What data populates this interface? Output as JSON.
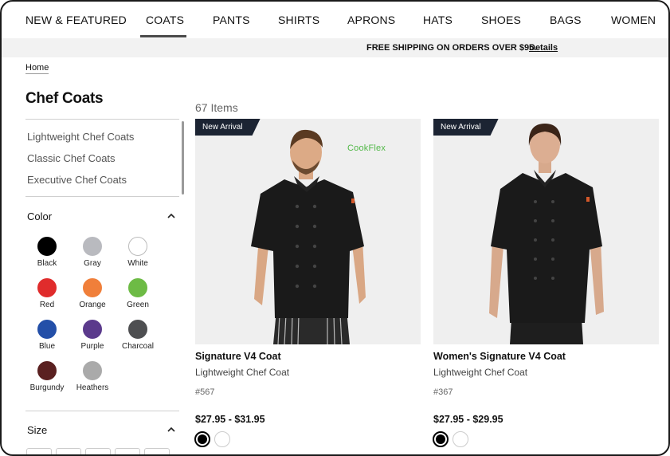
{
  "nav": {
    "items": [
      "NEW & FEATURED",
      "COATS",
      "PANTS",
      "SHIRTS",
      "APRONS",
      "HATS",
      "SHOES",
      "BAGS",
      "WOMEN"
    ],
    "active": "COATS"
  },
  "promo": {
    "text": "FREE SHIPPING ON ORDERS OVER $95.",
    "link": "Details"
  },
  "breadcrumb": "Home",
  "page_title": "Chef Coats",
  "categories": [
    "Lightweight Chef Coats",
    "Classic Chef Coats",
    "Executive Chef Coats"
  ],
  "color_facet": {
    "label": "Color",
    "swatches": [
      {
        "name": "Black",
        "color": "#000000"
      },
      {
        "name": "Gray",
        "color": "#b9babf"
      },
      {
        "name": "White",
        "color": "#ffffff"
      },
      {
        "name": "Red",
        "color": "#e02c2c"
      },
      {
        "name": "Orange",
        "color": "#f07f3a"
      },
      {
        "name": "Green",
        "color": "#6dbb45"
      },
      {
        "name": "Blue",
        "color": "#234fa8"
      },
      {
        "name": "Purple",
        "color": "#5b3a8c"
      },
      {
        "name": "Charcoal",
        "color": "#4e4f51"
      },
      {
        "name": "Burgundy",
        "color": "#5a2020"
      },
      {
        "name": "Heathers",
        "color": "#aaaaaa"
      }
    ]
  },
  "size_facet": {
    "label": "Size"
  },
  "results": {
    "count": "67 Items"
  },
  "products": [
    {
      "badge": "New Arrival",
      "brand_mark": "CookFlex",
      "name": "Signature V4 Coat",
      "subtitle": "Lightweight Chef Coat",
      "sku": "#567",
      "price": "$27.95 - $31.95",
      "swatches": [
        "#000000",
        "#ffffff"
      ]
    },
    {
      "badge": "New Arrival",
      "name": "Women's Signature V4 Coat",
      "subtitle": "Lightweight Chef Coat",
      "sku": "#367",
      "price": "$27.95 - $29.95",
      "swatches": [
        "#000000",
        "#ffffff"
      ]
    }
  ],
  "colors": {
    "accent": "#4a4a4a",
    "badge_bg": "#1c2433",
    "promo_bg": "#f2f2f2"
  }
}
